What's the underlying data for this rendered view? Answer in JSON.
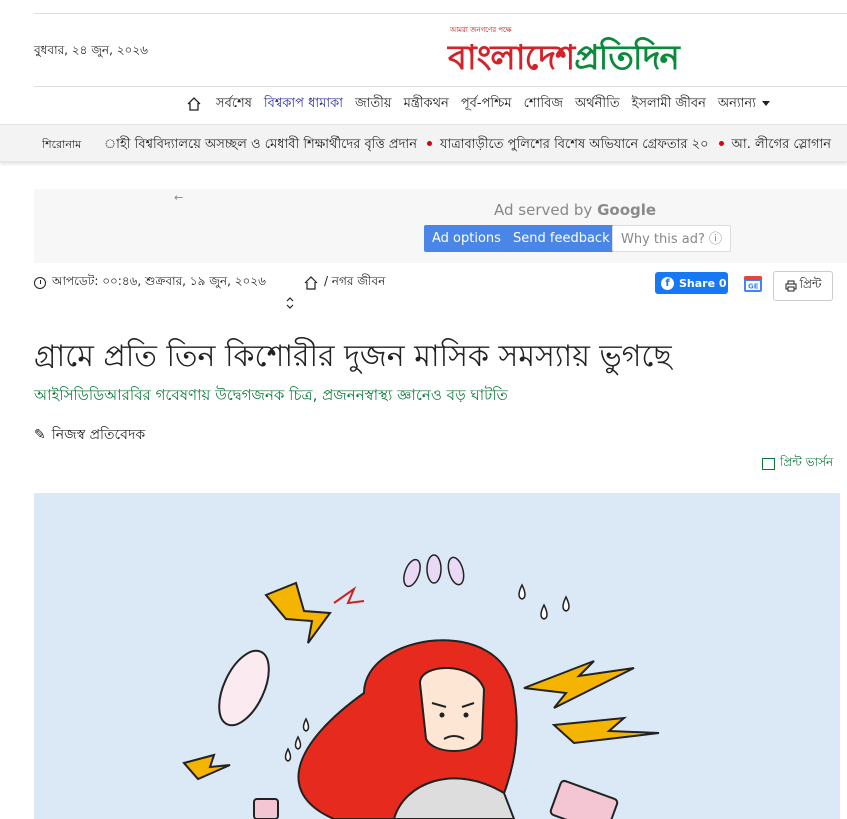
{
  "header": {
    "date": "বুধবার, ২৪ জুন, ২০২৬",
    "logo_tagline": "আমরা জনগণের পক্ষে",
    "logo_part1": "বাংলাদেশ",
    "logo_part2": "প্রতিদিন"
  },
  "nav": {
    "items": [
      "সর্বশেষ",
      "বিশ্বকাপ ধামাকা",
      "জাতীয়",
      "মন্ত্রীকথন",
      "পূর্ব-পশ্চিম",
      "শোবিজ",
      "অর্থনীতি",
      "ইসলামী জীবন",
      "অন্যান্য"
    ]
  },
  "ticker": {
    "label": "শিরোনাম",
    "items": [
      "াহী বিশ্ববিদ্যালয়ে অসচ্ছল ও মেধাবী শিক্ষার্থীদের বৃত্তি প্রদান",
      "যাত্রাবাড়ীতে পুলিশের বিশেষ অভিযানে গ্রেফতার ২০",
      "আ. লীগের স্লোগান"
    ]
  },
  "ad": {
    "back": "←",
    "served_prefix": "Ad served by",
    "served_brand": "Google",
    "options": "Ad options",
    "feedback": "Send feedback",
    "why": "Why this ad? ⓘ"
  },
  "article": {
    "updated": "আপডেট: ০০:৪৬, শুক্রবার, ১৯ জুন, ২০২৬",
    "category": "/ নগর জীবন",
    "share_label": "Share 0",
    "print_label": "প্রিন্ট",
    "headline": "গ্রামে প্রতি তিন কিশোরীর দুজন মাসিক সমস্যায় ভুগছে",
    "subheadline": "আইসিডিডিআরবির গবেষণায় উদ্বেগজনক চিত্র, প্রজননস্বাস্থ্য জ্ঞানেও বড় ঘাটতি",
    "author": "নিজস্ব প্রতিবেদক",
    "print_version": "প্রিন্ট ভার্সন"
  },
  "colors": {
    "brand_red": "#d2232a",
    "brand_green": "#0a8a3a",
    "link_green": "#0a7a3a",
    "nav_highlight": "#2a2aa6",
    "fb_blue": "#1877f2",
    "ad_blue": "#4a86e8"
  }
}
